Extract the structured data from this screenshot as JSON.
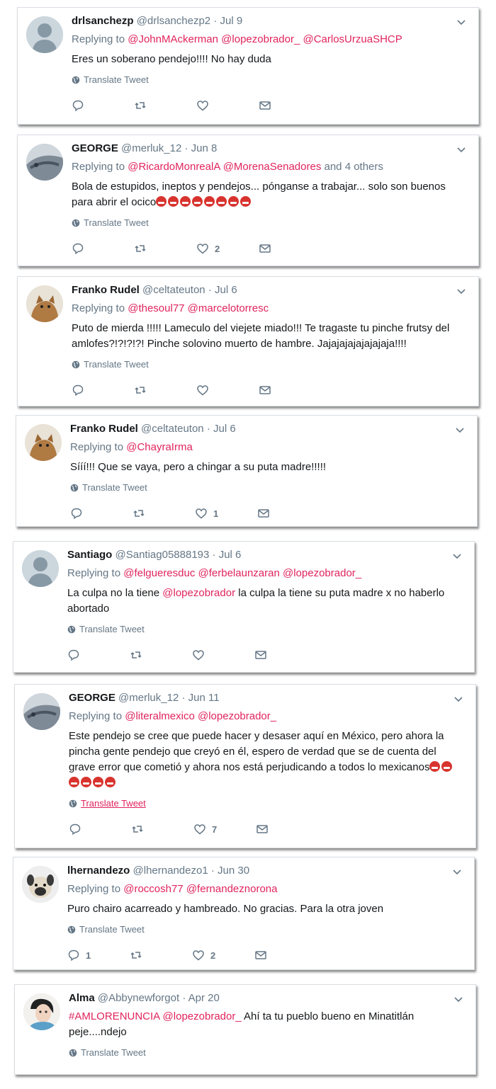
{
  "colors": {
    "accent": "#e0245e",
    "muted": "#657786",
    "text": "#14171a"
  },
  "icons": {
    "reply": "reply-icon",
    "retweet": "retweet-icon",
    "like": "heart-icon",
    "dm": "envelope-icon",
    "menu": "chevron-down-icon",
    "translate": "globe-icon"
  },
  "tweets": [
    {
      "name": "drlsanchezp",
      "handle": "@drlsanchezp2",
      "date": "Jul 9",
      "replying_prefix": "Replying to",
      "replying_to": [
        "@JohnMAckerman",
        "@lopezobrador_",
        "@CarlosUrzuaSHCP"
      ],
      "replying_suffix": "",
      "text": "Eres un soberano pendejo!!!! No hay duda",
      "translate": "Translate Tweet",
      "replies": "",
      "retweets": "",
      "likes": ""
    },
    {
      "name": "GEORGE",
      "handle": "@merluk_12",
      "date": "Jun 8",
      "replying_prefix": "Replying to",
      "replying_to": [
        "@RicardoMonrealA",
        "@MorenaSenadores"
      ],
      "replying_suffix": "and 4 others",
      "text": "Bola de estupidos, ineptos y pendejos... pónganse a trabajar... solo son buenos para abrir el ocico",
      "emoji_count": 8,
      "translate": "Translate Tweet",
      "replies": "",
      "retweets": "",
      "likes": "2"
    },
    {
      "name": "Franko Rudel",
      "handle": "@celtateuton",
      "date": "Jul 6",
      "replying_prefix": "Replying to",
      "replying_to": [
        "@thesoul77",
        "@marcelotorresc"
      ],
      "replying_suffix": "",
      "text": "Puto de mierda !!!!! Lameculo del viejete miado!!! Te tragaste tu pinche frutsy del amlofes?!?!?!?! Pinche solovino muerto de hambre. Jajajajajajajajaja!!!!",
      "translate": "Translate Tweet",
      "replies": "",
      "retweets": "",
      "likes": ""
    },
    {
      "name": "Franko Rudel",
      "handle": "@celtateuton",
      "date": "Jul 6",
      "replying_prefix": "Replying to",
      "replying_to": [
        "@ChayraIrma"
      ],
      "replying_suffix": "",
      "text": "Sííí!!! Que se vaya, pero a chingar a su puta madre!!!!!",
      "translate": "Translate Tweet",
      "replies": "",
      "retweets": "",
      "likes": "1"
    },
    {
      "name": "Santiago",
      "handle": "@Santiag05888193",
      "date": "Jul 6",
      "replying_prefix": "Replying to",
      "replying_to": [
        "@felgueresduc",
        "@ferbelaunzaran",
        "@lopezobrador_"
      ],
      "replying_suffix": "",
      "text_before": "La culpa no la tiene ",
      "text_mention": "@lopezobrador",
      "text_after": " la culpa la tiene su puta madre x no haberlo abortado",
      "translate": "Translate Tweet",
      "replies": "",
      "retweets": "",
      "likes": ""
    },
    {
      "name": "GEORGE",
      "handle": "@merluk_12",
      "date": "Jun 11",
      "replying_prefix": "Replying to",
      "replying_to": [
        "@literalmexico",
        "@lopezobrador_"
      ],
      "replying_suffix": "",
      "text": "Este pendejo se cree que puede hacer y desaser aquí en México, pero ahora la pincha gente pendejo que creyó en él, espero de verdad que se de cuenta del grave error que cometió y ahora nos está perjudicando a todos lo mexicanos",
      "emoji_count": 6,
      "translate": "Translate Tweet",
      "replies": "",
      "retweets": "",
      "likes": "7"
    },
    {
      "name": "lhernandezo",
      "handle": "@lhernandezo1",
      "date": "Jun 30",
      "replying_prefix": "Replying to",
      "replying_to": [
        "@roccosh77",
        "@fernandeznorona"
      ],
      "replying_suffix": "",
      "text": "Puro chairo acarreado y hambreado. No gracias. Para la otra joven",
      "translate": "Translate Tweet",
      "replies": "1",
      "retweets": "",
      "likes": "2"
    },
    {
      "name": "Alma",
      "handle": "@Abbynewforgot",
      "date": "Apr 20",
      "hashtag": "#AMLORENUNCIA",
      "mention": "@lopezobrador_",
      "text": "  Ahí ta tu pueblo bueno en Minatitlán peje....ndejo",
      "translate": "Translate Tweet"
    }
  ]
}
